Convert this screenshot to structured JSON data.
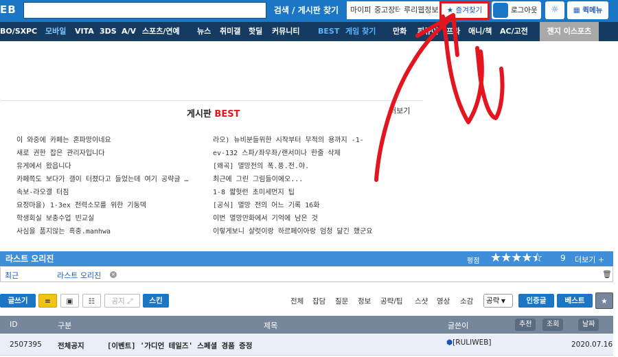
{
  "topbar": {
    "logo": "EB",
    "search_button": "검색 / 게시판 찾기",
    "links": [
      "마이피",
      "중고장터",
      "루리웹정보"
    ],
    "favorites": "★ 즐겨찾기",
    "login": "로그아웃",
    "gear": "☼",
    "quick_menu": "퀵메뉴"
  },
  "nav": {
    "items": [
      "BO/SX",
      "PC",
      "모바일",
      "VITA",
      "3DS",
      "A/V",
      "스포츠/연예",
      "뉴스",
      "취미갤",
      "핫딜",
      "커뮤니티",
      "BEST",
      "게임 찾기",
      "만화",
      "피규어",
      "프라",
      "애니/책",
      "AC/고전"
    ],
    "esports": "젠지 이스포츠"
  },
  "best": {
    "title": "게시판",
    "title_red": "BEST",
    "more": "더보기",
    "left_list": [
      "이 와중에 카페는 혼파망이네요",
      "새로 권한 잡은 관리자입니다",
      "유게에서 왔읍니다",
      "카페쪽도 보다가 갤이 터졌다고 들었는데 여기 공략글 …",
      "속보-라오갤 터짐",
      "요정마을) 1-3ex 전력소모를 위한 기동덱",
      "학생회실 보충수업 빈교실",
      "사심을 품지않는 흑충.manhwa"
    ],
    "right_list": [
      "라오) 뉴비분들위한 시작부터 무적의 용까지 -1-",
      "ev-132 스파/좌우좌/랜서미나 한줄 삭제",
      "[왜곡] 멸망전의 폭.풍.전.야.",
      "최근에 그린 그림들이에오...",
      "1-8 짧헛런 초미세먼지 팁",
      "[공식] 멸망 전의 어느 기록 16화",
      "이번 멸망만화에서 기억에 남은 것",
      "이렇게보니 샬럿이랑 하르페이아랑 엄청 닮긴 했군요"
    ]
  },
  "board": {
    "name": "라스트 오리진",
    "rating_label": "평점",
    "rating_value": 4.5,
    "rating_text": "9",
    "more": "더보기 +",
    "tab_recent": "최근",
    "tab_board": "라스트 오리진"
  },
  "toolbar": {
    "write": "글쓰기",
    "notice": "공지 ⤢",
    "skin": "스킨",
    "filters": [
      "전체",
      "잡담",
      "질문",
      "정보",
      "공략/팁",
      "스샷",
      "영상",
      "소감"
    ],
    "select_value": "공략",
    "verified": "인증글",
    "best": "베스트",
    "star": "★"
  },
  "table": {
    "headers": {
      "id": "ID",
      "category": "구분",
      "title": "제목",
      "author": "글쓴이",
      "recommend": "추천",
      "views": "조회",
      "date": "날짜"
    },
    "rows": [
      {
        "id": "2507395",
        "category": "전체공지",
        "title": "[이벤트] '가디언 테일즈' 스페셜 경품 증정",
        "author": "[RULIWEB]",
        "date": "2020.07.16"
      }
    ]
  },
  "colors": {
    "brand": "#1c76c6",
    "nav": "#163b63",
    "annotation": "#e3151f"
  }
}
